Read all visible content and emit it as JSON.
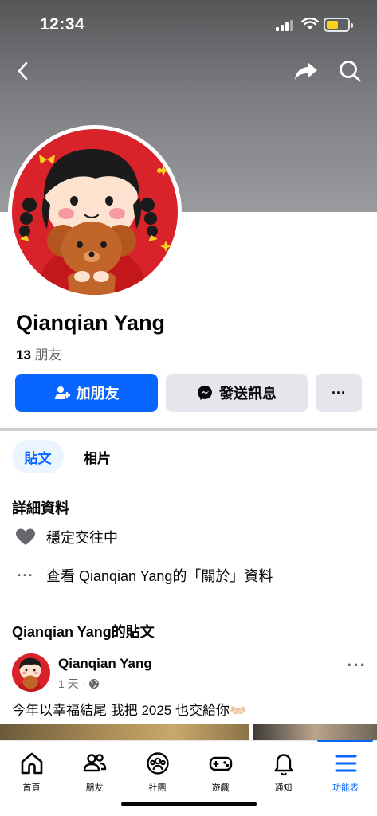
{
  "status_bar": {
    "time": "12:34"
  },
  "profile": {
    "name": "Qianqian Yang",
    "friend_count": "13",
    "friend_label": "朋友"
  },
  "actions": {
    "add_friend": "加朋友",
    "send_message": "發送訊息",
    "more": "···"
  },
  "tabs": [
    {
      "label": "貼文",
      "active": true
    },
    {
      "label": "相片",
      "active": false
    }
  ],
  "details": {
    "title": "詳細資料",
    "relationship": "穩定交往中",
    "about_link": "查看 Qianqian Yang的「關於」資料"
  },
  "posts_section": {
    "title": "Qianqian Yang的貼文"
  },
  "post": {
    "author": "Qianqian Yang",
    "time": "1 天",
    "separator": "·",
    "privacy_icon": "globe-icon",
    "more": "···",
    "text": "今年以幸福結尾 我把 2025 也交給你👐🏻"
  },
  "bottom_nav": [
    {
      "label": "首頁",
      "icon": "home-icon"
    },
    {
      "label": "朋友",
      "icon": "friends-icon"
    },
    {
      "label": "社團",
      "icon": "groups-icon"
    },
    {
      "label": "遊戲",
      "icon": "gaming-icon"
    },
    {
      "label": "通知",
      "icon": "bell-icon"
    },
    {
      "label": "功能表",
      "icon": "menu-icon",
      "active": true
    }
  ],
  "colors": {
    "accent": "#0866ff",
    "secondary_button": "#e4e6eb",
    "avatar_background": "#d8232a"
  }
}
